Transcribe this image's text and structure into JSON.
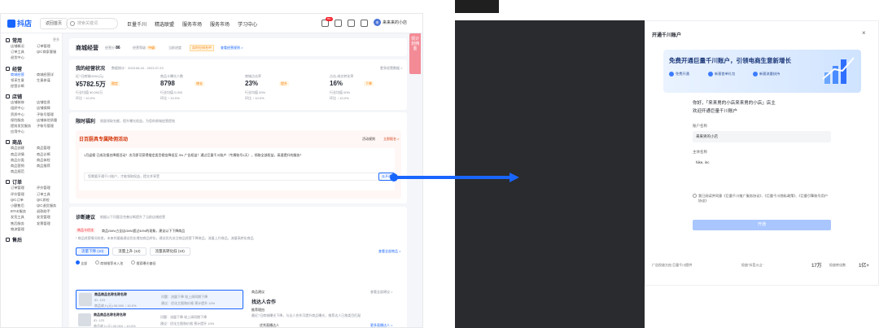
{
  "app": {
    "logo": "抖店",
    "home_button": "返回首页",
    "search_placeholder": "搜索关键词",
    "nav": [
      "巨量千川",
      "精选联盟",
      "服务市场",
      "服务市场",
      "学习中心"
    ],
    "badge": "99+",
    "user": "来来来的小店",
    "side_tab": "领计划佣金",
    "sidebar": {
      "sections": [
        {
          "title": "常用",
          "more": "更多",
          "items": [
            [
              "店铺概况",
              "订单管理"
            ],
            [
              "订单工具",
              "QIC商家客服"
            ],
            [
              "退货中心",
              ""
            ]
          ]
        },
        {
          "title": "经营",
          "items": [
            [
              "商城经营",
              "商城经营详"
            ],
            [
              "领享生意",
              "生意参谋"
            ],
            [
              "经营诊断",
              ""
            ]
          ]
        },
        {
          "title": "店铺",
          "items": [
            [
              "店铺装修",
              "店铺信息"
            ],
            [
              "组织中心",
              "店铺保障"
            ],
            [
              "资质中心",
              "子账号管理"
            ],
            [
              "保险服务",
              "店铺体验质量"
            ],
            [
              "提前发货服务",
              "子帐号管理"
            ],
            [
              "应用中心",
              ""
            ]
          ]
        },
        {
          "title": "商品",
          "items": [
            [
              "商品创建",
              "商品管理"
            ],
            [
              "商品详情",
              "商品诊断"
            ],
            [
              "商品分类",
              "商品体检"
            ],
            [
              "商品营销",
              "商品推荐"
            ],
            [
              "商品规范",
              ""
            ]
          ]
        },
        {
          "title": "订单",
          "items": [
            [
              "订单管理",
              "评价管理"
            ],
            [
              "评价管理",
              "订单工具"
            ],
            [
              "QIC订单",
              "QIC质检"
            ],
            [
              "小额售后",
              "QIC退货服务"
            ],
            [
              "BTAE服务",
              "退款助手"
            ],
            [
              "发货工具",
              "发货管理"
            ],
            [
              "售后服务",
              "发票管理"
            ],
            [
              "物流管理",
              ""
            ]
          ]
        },
        {
          "title": "售后",
          "items": []
        }
      ]
    },
    "header": {
      "title": "商城经营",
      "score_label": "经营分",
      "score": "86",
      "level_label": "经营等级",
      "level": "中级",
      "progress_label": "当前进度",
      "progress_tag": "实时分排名中",
      "link": "查看经营规则 >"
    },
    "status": {
      "title": "我的经营状况",
      "subtitle": "数据统计：2023.06.24 - 2023.07.23",
      "link": "更多经营数据 >",
      "metrics": [
        {
          "label": "近7日商城GMV(元)",
          "value": "¥5782.5万",
          "tag": "稳定",
          "sub1": "行业均值 ¥0,000万",
          "sub2": "环比 ↑ 10.0%"
        },
        {
          "label": "商品卡曝光人数",
          "value": "8798",
          "tag": "增长",
          "sub1": "行业均值 0,000",
          "sub2": "环比 ↑ 10.0%"
        },
        {
          "label": "商城点击率",
          "value": "23%",
          "tag": "提升",
          "sub1": "行业均值 00%",
          "sub2": "环比 ↑ 10.0%"
        },
        {
          "label": "点击-成交转化率",
          "value": "16%",
          "tag": "下降",
          "sub1": "行业均值 00%",
          "sub2": "环比 ↓ 10.0%"
        }
      ]
    },
    "benefit": {
      "title": "限时福利",
      "subtitle": "限量领取名额，提升曝光权益，为您的商城经营提效"
    },
    "activity": {
      "title": "日百厨具专属降佣活动",
      "tag_link": "活动规则",
      "enroll": "立即报名 >",
      "line": "1月返佣  已成功报名降佣活动！次月即可获得指定类目佣金降低至 3% 广告权益！通过巨量千川账户（专属账号1天），领取全部权益，高速提升的服务！",
      "check": "您需要开通千川账户，才能领取权益，提交并享受",
      "btn": "去开通"
    },
    "diag": {
      "title": "诊断建议",
      "subtitle": "根据以下问题及完善诊断提升了当前店铺经营",
      "warn_tag": "商品卡优化",
      "warn": "商品GMV占全店GMV超过40%的现象，建议以下下降商品",
      "note": "* 商品经营情况较差，未来的量级建议优化增加商品转化，建议优先关注商品经营下降商品，流量上升商品，流量高转化商品",
      "link": "查看全部商品 >",
      "tabs": [
        "流量下降 (10)",
        "流量上升 (12)",
        "流量高转化低 (10)"
      ],
      "radios": [
        "全部",
        "商城推荐未入池",
        "搜索曝光偏低"
      ]
    },
    "products": [
      {
        "name": "商品商品名称名称名称",
        "id": "ID: 123",
        "meta": "商品收入(元) 00,000  ↓ 10.0%",
        "desc": "问题：流量下降 较上周同期下降",
        "suggest": "建议：优化主图和价格 预计提升 10%"
      },
      {
        "name": "商品商品名称名称名称",
        "id": "ID: 123",
        "meta": "商品收入(元) 00,000  ↓ 10.0%",
        "desc": "问题：流量下降 较上周同期下降",
        "suggest": "建议：优化主图和价格 预计提升 10%"
      }
    ],
    "suggest": {
      "label": "商品建议",
      "link": "查看全部建议 >",
      "title": "找达人合作",
      "reason_h": "推荐理由",
      "reason": "最近7日商城曝光下降，与达人合作可提升商品曝光，推荐达人已按类目匹配",
      "sub": "优秀直播达人",
      "more": "更多直播达人 >"
    }
  },
  "modal": {
    "title": "开通千川账户",
    "close": "×",
    "banner_title": "免费开通巨量千川账户，引领电商生意新增长",
    "chips": [
      "免费开通",
      "新客首单礼包",
      "新客流量扶持"
    ],
    "greet": "你好，「来来男的小店来来男的小店」店主",
    "welcome": "欢迎开通巨量千川账户",
    "account_label": "账户名称",
    "account_value": "来来男的小店",
    "entity_label": "主体名称",
    "entity_value": "hike, inc",
    "agree": "我已阅读并同意《巨量千川推广服务协议》、《巨量千川隐私政策》、《巨量引擎账号用户协议》",
    "submit": "开通",
    "foot_left": "广告投放方由 巨量千川提供",
    "foot_mid": "投放“抖音火山”",
    "foot_mid_num": "17万",
    "foot_right": "投放转化数",
    "foot_right_num": "1亿+"
  },
  "colors": {
    "accent": "#1966ff",
    "warning": "#ff7d00",
    "pink_tab": "#f38b96"
  }
}
